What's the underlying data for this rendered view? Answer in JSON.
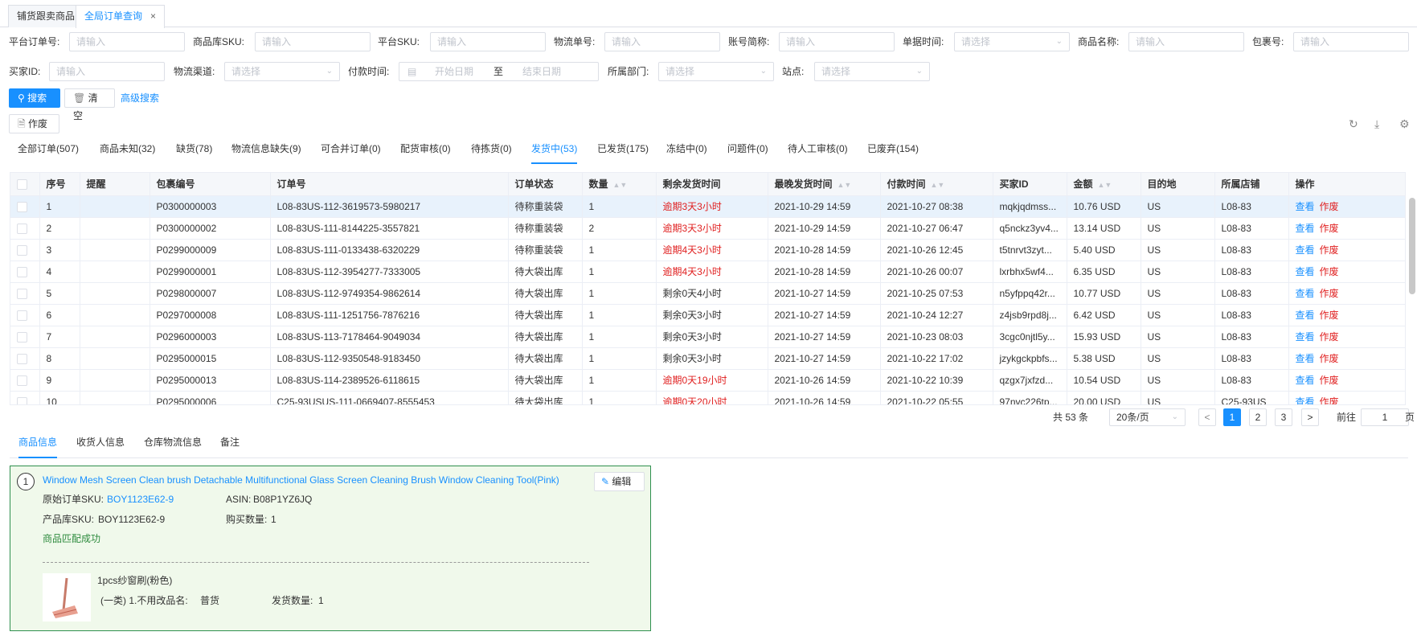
{
  "page_tabs": [
    {
      "label": "铺货跟卖商品"
    },
    {
      "label": "全局订单查询"
    }
  ],
  "close_glyph": "×",
  "filters": {
    "platform_order_no": {
      "label": "平台订单号:",
      "placeholder": "请输入"
    },
    "product_sku": {
      "label": "商品库SKU:",
      "placeholder": "请输入"
    },
    "platform_sku": {
      "label": "平台SKU:",
      "placeholder": "请输入"
    },
    "tracking_no": {
      "label": "物流单号:",
      "placeholder": "请输入"
    },
    "account_abbr": {
      "label": "账号简称:",
      "placeholder": "请输入"
    },
    "doc_time": {
      "label": "单据时间:",
      "placeholder": "请选择"
    },
    "product_name": {
      "label": "商品名称:",
      "placeholder": "请输入"
    },
    "package_no": {
      "label": "包裹号:",
      "placeholder": "请输入"
    },
    "buyer_id": {
      "label": "买家ID:",
      "placeholder": "请输入"
    },
    "logistics_channel": {
      "label": "物流渠道:",
      "placeholder": "请选择"
    },
    "pay_time": {
      "label": "付款时间:",
      "start": "开始日期",
      "to": "至",
      "end": "结束日期"
    },
    "department": {
      "label": "所属部门:",
      "placeholder": "请选择"
    },
    "site": {
      "label": "站点:",
      "placeholder": "请选择"
    }
  },
  "actions": {
    "search": "搜索",
    "clear": "清空",
    "advanced": "高级搜索",
    "void": "作废"
  },
  "status_tabs": [
    "全部订单(507)",
    "商品未知(32)",
    "缺货(78)",
    "物流信息缺失(9)",
    "可合并订单(0)",
    "配货审核(0)",
    "待拣货(0)",
    "发货中(53)",
    "已发货(175)",
    "冻结中(0)",
    "问题件(0)",
    "待人工审核(0)",
    "已废弃(154)"
  ],
  "table": {
    "headers": [
      "序号",
      "提醒",
      "包裹编号",
      "订单号",
      "订单状态",
      "数量",
      "剩余发货时间",
      "最晚发货时间",
      "付款时间",
      "买家ID",
      "金额",
      "目的地",
      "所属店铺",
      "操作"
    ],
    "op_view": "查看",
    "op_void": "作废",
    "rows": [
      {
        "no": "1",
        "remind": "",
        "pkg": "P0300000003",
        "order": "L08-83US-112-3619573-5980217",
        "status": "待称重装袋",
        "qty": "1",
        "remain": "逾期3天3小时",
        "overdue": true,
        "latest": "2021-10-29 14:59",
        "pay": "2021-10-27 08:38",
        "buyer": "mqkjqdmss...",
        "amount": "10.76 USD",
        "dest": "US",
        "shop": "L08-83"
      },
      {
        "no": "2",
        "remind": "",
        "pkg": "P0300000002",
        "order": "L08-83US-111-8144225-3557821",
        "status": "待称重装袋",
        "qty": "2",
        "remain": "逾期3天3小时",
        "overdue": true,
        "latest": "2021-10-29 14:59",
        "pay": "2021-10-27 06:47",
        "buyer": "q5nckz3yv4...",
        "amount": "13.14 USD",
        "dest": "US",
        "shop": "L08-83"
      },
      {
        "no": "3",
        "remind": "",
        "pkg": "P0299000009",
        "order": "L08-83US-111-0133438-6320229",
        "status": "待称重装袋",
        "qty": "1",
        "remain": "逾期4天3小时",
        "overdue": true,
        "latest": "2021-10-28 14:59",
        "pay": "2021-10-26 12:45",
        "buyer": "t5tnrvt3zyt...",
        "amount": "5.40 USD",
        "dest": "US",
        "shop": "L08-83"
      },
      {
        "no": "4",
        "remind": "",
        "pkg": "P0299000001",
        "order": "L08-83US-112-3954277-7333005",
        "status": "待大袋出库",
        "qty": "1",
        "remain": "逾期4天3小时",
        "overdue": true,
        "latest": "2021-10-28 14:59",
        "pay": "2021-10-26 00:07",
        "buyer": "lxrbhx5wf4...",
        "amount": "6.35 USD",
        "dest": "US",
        "shop": "L08-83"
      },
      {
        "no": "5",
        "remind": "",
        "pkg": "P0298000007",
        "order": "L08-83US-112-9749354-9862614",
        "status": "待大袋出库",
        "qty": "1",
        "remain": "剩余0天4小时",
        "overdue": false,
        "latest": "2021-10-27 14:59",
        "pay": "2021-10-25 07:53",
        "buyer": "n5yfppq42r...",
        "amount": "10.77 USD",
        "dest": "US",
        "shop": "L08-83"
      },
      {
        "no": "6",
        "remind": "",
        "pkg": "P0297000008",
        "order": "L08-83US-111-1251756-7876216",
        "status": "待大袋出库",
        "qty": "1",
        "remain": "剩余0天3小时",
        "overdue": false,
        "latest": "2021-10-27 14:59",
        "pay": "2021-10-24 12:27",
        "buyer": "z4jsb9rpd8j...",
        "amount": "6.42 USD",
        "dest": "US",
        "shop": "L08-83"
      },
      {
        "no": "7",
        "remind": "",
        "pkg": "P0296000003",
        "order": "L08-83US-113-7178464-9049034",
        "status": "待大袋出库",
        "qty": "1",
        "remain": "剩余0天3小时",
        "overdue": false,
        "latest": "2021-10-27 14:59",
        "pay": "2021-10-23 08:03",
        "buyer": "3cgc0njtl5y...",
        "amount": "15.93 USD",
        "dest": "US",
        "shop": "L08-83"
      },
      {
        "no": "8",
        "remind": "",
        "pkg": "P0295000015",
        "order": "L08-83US-112-9350548-9183450",
        "status": "待大袋出库",
        "qty": "1",
        "remain": "剩余0天3小时",
        "overdue": false,
        "latest": "2021-10-27 14:59",
        "pay": "2021-10-22 17:02",
        "buyer": "jzykgckpbfs...",
        "amount": "5.38 USD",
        "dest": "US",
        "shop": "L08-83"
      },
      {
        "no": "9",
        "remind": "",
        "pkg": "P0295000013",
        "order": "L08-83US-114-2389526-6118615",
        "status": "待大袋出库",
        "qty": "1",
        "remain": "逾期0天19小时",
        "overdue": true,
        "latest": "2021-10-26 14:59",
        "pay": "2021-10-22 10:39",
        "buyer": "qzgx7jxfzd...",
        "amount": "10.54 USD",
        "dest": "US",
        "shop": "L08-83"
      },
      {
        "no": "10",
        "remind": "",
        "pkg": "P0295000006",
        "order": "C25-93USUS-111-0669407-8555453",
        "status": "待大袋出库",
        "qty": "1",
        "remain": "逾期0天20小时",
        "overdue": true,
        "latest": "2021-10-26 14:59",
        "pay": "2021-10-22 05:55",
        "buyer": "97nvc226tp...",
        "amount": "20.00 USD",
        "dest": "US",
        "shop": "C25-93US"
      }
    ]
  },
  "pagination": {
    "total": "共 53 条",
    "page_size": "20条/页",
    "pages": [
      "1",
      "2",
      "3"
    ],
    "current": "1",
    "goto_label": "前往",
    "goto_value": "1",
    "goto_suffix": "页",
    "prev": "<",
    "next": ">"
  },
  "detail_tabs": [
    "商品信息",
    "收货人信息",
    "仓库物流信息",
    "备注"
  ],
  "product_card": {
    "index": "1",
    "title": "Window Mesh Screen Clean brush Detachable Multifunctional Glass Screen Cleaning Brush Window Cleaning Tool(Pink)",
    "edit": "编辑",
    "orig_sku_label": "原始订单SKU:",
    "orig_sku": "BOY1123E62-9",
    "asin_label": "ASIN:",
    "asin": "B08P1YZ6JQ",
    "lib_sku_label": "产品库SKU:",
    "lib_sku": "BOY1123E62-9",
    "buy_qty_label": "购买数量:",
    "buy_qty": "1",
    "match_status": "商品匹配成功",
    "item_name": "1pcs纱窗刷(粉色)",
    "item_category": "(一类) 1.不用改品名:",
    "item_type": "普货",
    "ship_qty_label": "发货数量:",
    "ship_qty": "1"
  }
}
